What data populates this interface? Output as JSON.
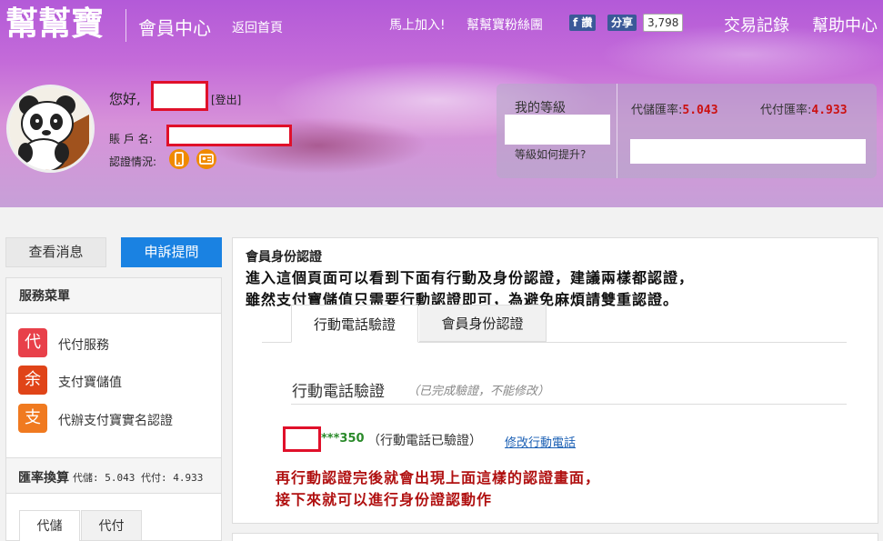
{
  "header": {
    "logo": "幫幫寶",
    "member_center": "會員中心",
    "back_home": "返回首頁",
    "join_now": "馬上加入!",
    "fan_group": "幫幫寶粉絲團",
    "fb_like": "f 讚",
    "fb_share": "分享",
    "fb_count": "3,798",
    "trade_records": "交易記錄",
    "help_center": "幫助中心"
  },
  "user": {
    "greeting": "您好,",
    "logout": "[登出]",
    "account_label": "賬 戶 名:",
    "verify_label": "認證情況:",
    "verify_icons": [
      "phone-icon",
      "id-card-icon"
    ]
  },
  "level": {
    "title": "我的等級",
    "how_to_upgrade": "等級如何提升?",
    "storage_rate_label": "代儲匯率:",
    "storage_rate": "5.043",
    "payment_rate_label": "代付匯率:",
    "payment_rate": "4.933"
  },
  "left": {
    "view_messages": "查看消息",
    "complaint": "申訴提問",
    "menu_title": "服務菜單",
    "menu_items": [
      {
        "icon_char": "代",
        "label": "代付服務",
        "color": "#e8404a"
      },
      {
        "icon_char": "余",
        "label": "支付寶儲值",
        "color": "#e04418"
      },
      {
        "icon_char": "支",
        "label": "代辦支付寶實名認證",
        "color": "#f07a20"
      }
    ],
    "rate_title": "匯率換算",
    "rate_small": "代儲: 5.043 代付: 4.933",
    "tab_storage": "代儲",
    "tab_payment": "代付"
  },
  "main": {
    "title": "會員身份認證",
    "note_line1": "進入這個頁面可以看到下面有行動及身份認證，建議兩樣都認證，",
    "note_line2": "雖然支付寶儲值只需要行動認證即可，為避免麻煩請雙重認證。",
    "tab_phone": "行動電話驗證",
    "tab_id": "會員身份認證",
    "phone_title": "行動電話驗證",
    "phone_title_note": "（已完成驗證，不能修改）",
    "phone_number": "***350",
    "phone_status": "（行動電話已驗證）",
    "phone_edit": "修改行動電話",
    "note_line3": "再行動認證完後就會出現上面這樣的認證畫面，",
    "note_line4": "接下來就可以進行身份證認動作"
  },
  "colors": {
    "accent_blue": "#1a82e2",
    "redact_red": "#e0102a",
    "rate_red": "#cc1010",
    "note_red": "#b01010"
  }
}
